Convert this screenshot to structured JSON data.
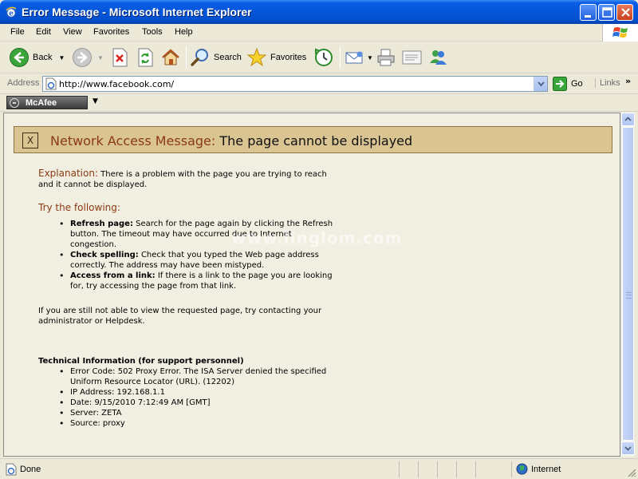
{
  "window": {
    "title": "Error Message - Microsoft Internet Explorer"
  },
  "menu": [
    "File",
    "Edit",
    "View",
    "Favorites",
    "Tools",
    "Help"
  ],
  "toolbar": {
    "back": "Back",
    "search": "Search",
    "favorites": "Favorites"
  },
  "address": {
    "label": "Address",
    "url": "http://www.facebook.com/",
    "go": "Go",
    "links": "Links"
  },
  "mcafee": {
    "label": "McAfee"
  },
  "error": {
    "banner_x": "X",
    "banner_prefix": "Network Access Message:",
    "banner_title": "The page cannot be displayed",
    "explanation_label": "Explanation:",
    "explanation_text": "There is a problem with the page you are trying to reach and it cannot be displayed.",
    "try_heading": "Try the following:",
    "tips": [
      {
        "term": "Refresh page:",
        "text": "Search for the page again by clicking the Refresh button. The timeout may have occurred due to Internet congestion."
      },
      {
        "term": "Check spelling:",
        "text": "Check that you typed the Web page address correctly. The address may have been mistyped."
      },
      {
        "term": "Access from a link:",
        "text": "If there is a link to the page you are looking for, try accessing the page from that link."
      }
    ],
    "contact_text": "If you are still not able to view the requested page, try contacting your administrator or Helpdesk.",
    "tech_heading": "Technical Information (for support personnel)",
    "tech_items": [
      "Error Code: 502 Proxy Error. The ISA Server denied the specified Uniform Resource Locator (URL). (12202)",
      "IP Address: 192.168.1.1",
      "Date: 9/15/2010 7:12:49 AM [GMT]",
      "Server: ZETA",
      "Source: proxy"
    ]
  },
  "watermark": "www.linglom.com",
  "status": {
    "text": "Done",
    "zone": "Internet"
  }
}
